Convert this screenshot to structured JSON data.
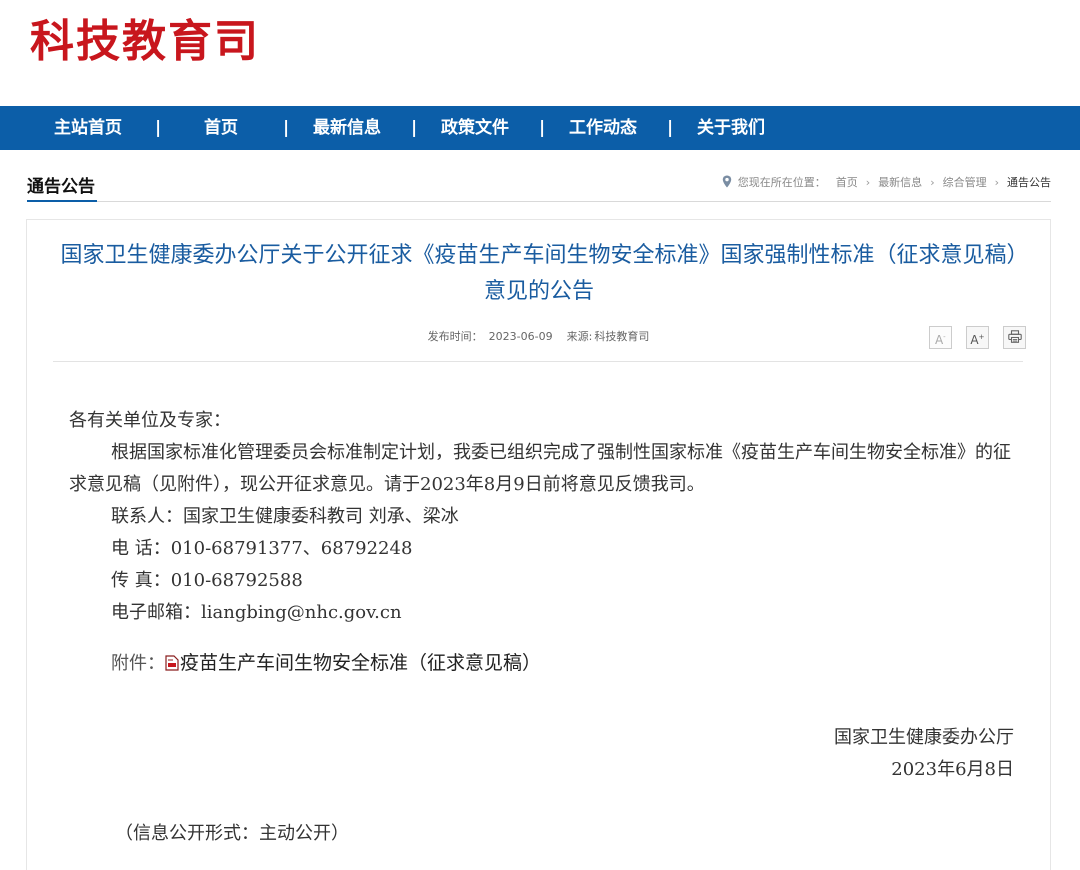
{
  "site": {
    "logo_text": "科技教育司"
  },
  "nav": {
    "items": [
      {
        "label": "主站首页"
      },
      {
        "label": "首页"
      },
      {
        "label": "最新信息"
      },
      {
        "label": "政策文件"
      },
      {
        "label": "工作动态"
      },
      {
        "label": "关于我们"
      }
    ],
    "separator": "|"
  },
  "section": {
    "title": "通告公告"
  },
  "breadcrumb": {
    "prefix": "您现在所在位置：",
    "items": [
      "首页",
      "最新信息",
      "综合管理",
      "通告公告"
    ],
    "separator": "›"
  },
  "article": {
    "title": "国家卫生健康委办公厅关于公开征求《疫苗生产车间生物安全标准》国家强制性标准（征求意见稿）意见的公告",
    "meta": {
      "date_label": "发布时间：",
      "date": "2023-06-09",
      "source_label": "来源:",
      "source": "科技教育司"
    },
    "tools": {
      "font_smaller": "A",
      "font_larger": "A",
      "minus": "-",
      "plus": "+"
    },
    "greeting": "各有关单位及专家：",
    "paragraph": "根据国家标准化管理委员会标准制定计划，我委已组织完成了强制性国家标准《疫苗生产车间生物安全标准》的征求意见稿（见附件），现公开征求意见。请于2023年8月9日前将意见反馈我司。",
    "contact": "联系人：国家卫生健康委科教司 刘承、梁冰",
    "phone": "电 话：010-68791377、68792248",
    "fax": "传 真：010-68792588",
    "email": "电子邮箱：liangbing@nhc.gov.cn",
    "attachment_label": "附件：",
    "attachment_link": "疫苗生产车间生物安全标准（征求意见稿）",
    "signer": "国家卫生健康委办公厅",
    "sign_date": "2023年6月8日",
    "disclosure": "（信息公开形式：主动公开）"
  }
}
